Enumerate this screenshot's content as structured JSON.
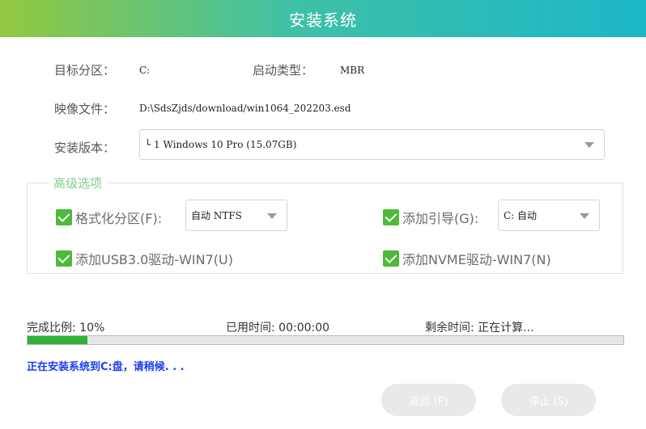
{
  "window": {
    "title": "安装系统"
  },
  "form": {
    "target_partition_label": "目标分区：",
    "target_partition_value": "C:",
    "boot_type_label": "启动类型：",
    "boot_type_value": "MBR",
    "image_file_label": "映像文件：",
    "image_file_value": "D:\\SdsZjds/download/win1064_202203.esd",
    "edition_label": "安装版本：",
    "edition_value": "└ 1 Windows 10 Pro (15.07GB)"
  },
  "advanced": {
    "legend": "高级选项",
    "format_partition": {
      "label": "格式化分区(F):",
      "checked": true,
      "select_value": "自动 NTFS"
    },
    "add_boot": {
      "label": "添加引导(G):",
      "checked": true,
      "select_value": "C: 自动"
    },
    "add_usb3": {
      "label": "添加USB3.0驱动-WIN7(U)",
      "checked": true
    },
    "add_nvme": {
      "label": "添加NVME驱动-WIN7(N)",
      "checked": true
    }
  },
  "progress": {
    "completion_text": "完成比例: 10%",
    "elapsed_text": "已用时间: 00:00:00",
    "remaining_text": "剩余时间: 正在计算...",
    "percent": 10,
    "status_message": "正在安装系统到C:盘，请稍候. . ."
  },
  "buttons": {
    "back": "返回 (P)",
    "stop": "停止 (S)"
  },
  "colors": {
    "header_gradient_start": "#93c83e",
    "header_gradient_end": "#1cb6c6",
    "check_green": "#4fb93a",
    "progress_fill": "#2fb13a",
    "status_blue": "#1a3df0"
  }
}
